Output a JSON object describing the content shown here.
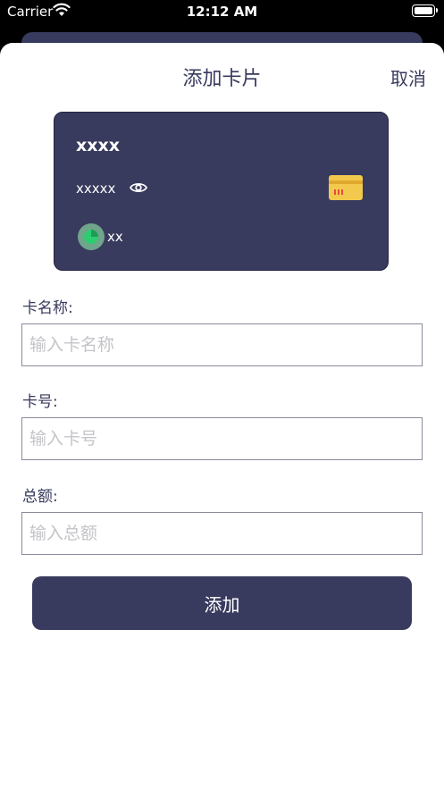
{
  "status_bar": {
    "carrier": "Carrier",
    "time": "12:12 AM"
  },
  "sheet": {
    "title": "添加卡片",
    "cancel_label": "取消"
  },
  "card_preview": {
    "name": "xxxx",
    "number": "xxxxx",
    "amount": "xx",
    "background_color": "#383a5e",
    "chip_color": "#f2c94c",
    "logo_color": "#2ecc71"
  },
  "form": {
    "card_name": {
      "label": "卡名称:",
      "placeholder": "输入卡名称",
      "value": ""
    },
    "card_number": {
      "label": "卡号:",
      "placeholder": "输入卡号",
      "value": ""
    },
    "total_amount": {
      "label": "总额:",
      "placeholder": "输入总额",
      "value": ""
    }
  },
  "submit": {
    "label": "添加"
  },
  "colors": {
    "primary": "#383a5e",
    "input_border": "#8a8a9a",
    "placeholder": "#c4c4c9"
  }
}
